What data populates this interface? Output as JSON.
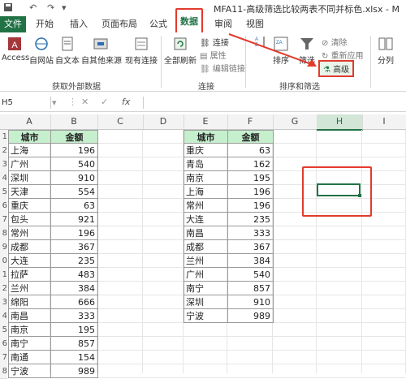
{
  "window": {
    "title": "MFA11-高级筛选比较两表不同并标色.xlsx - M"
  },
  "tabs": {
    "file": "文件",
    "home": "开始",
    "insert": "插入",
    "layout": "页面布局",
    "formulas": "公式",
    "data": "数据",
    "review": "审阅",
    "view": "视图"
  },
  "ribbon": {
    "access": "Access",
    "web": "自网站",
    "text": "自文本",
    "other": "自其他来源",
    "existing": "现有连接",
    "refresh_all": "全部刷新",
    "connections": "连接",
    "properties": "属性",
    "edit_links": "编辑链接",
    "sort": "排序",
    "filter": "筛选",
    "clear": "清除",
    "reapply": "重新应用",
    "advanced": "高级",
    "split": "分列",
    "group_external": "获取外部数据",
    "group_connections": "连接",
    "group_sort_filter": "排序和筛选"
  },
  "formula_bar": {
    "name_box": "H5",
    "fx": "fx"
  },
  "columns": [
    "A",
    "B",
    "C",
    "D",
    "E",
    "F",
    "G",
    "H",
    "I"
  ],
  "table1": {
    "header": [
      "城市",
      "金额"
    ],
    "rows": [
      [
        "上海",
        "196"
      ],
      [
        "广州",
        "540"
      ],
      [
        "深圳",
        "910"
      ],
      [
        "天津",
        "554"
      ],
      [
        "重庆",
        "63"
      ],
      [
        "包头",
        "921"
      ],
      [
        "常州",
        "196"
      ],
      [
        "成都",
        "367"
      ],
      [
        "大连",
        "235"
      ],
      [
        "拉萨",
        "483"
      ],
      [
        "兰州",
        "384"
      ],
      [
        "绵阳",
        "666"
      ],
      [
        "南昌",
        "333"
      ],
      [
        "南京",
        "195"
      ],
      [
        "南宁",
        "857"
      ],
      [
        "南通",
        "154"
      ],
      [
        "宁波",
        "989"
      ]
    ]
  },
  "table2": {
    "header": [
      "城市",
      "金额"
    ],
    "rows": [
      [
        "重庆",
        "63"
      ],
      [
        "青岛",
        "162"
      ],
      [
        "南京",
        "195"
      ],
      [
        "上海",
        "196"
      ],
      [
        "常州",
        "196"
      ],
      [
        "大连",
        "235"
      ],
      [
        "南昌",
        "333"
      ],
      [
        "成都",
        "367"
      ],
      [
        "兰州",
        "384"
      ],
      [
        "广州",
        "540"
      ],
      [
        "南宁",
        "857"
      ],
      [
        "深圳",
        "910"
      ],
      [
        "宁波",
        "989"
      ]
    ]
  },
  "row_numbers": [
    "1",
    "2",
    "3",
    "4",
    "5",
    "6",
    "7",
    "8",
    "9",
    "0",
    "1",
    "2",
    "3",
    "4",
    "5",
    "6",
    "7",
    "8"
  ],
  "colors": {
    "excel_green": "#217346",
    "header_fill": "#c6efce",
    "annotation_red": "#e23b2e"
  }
}
